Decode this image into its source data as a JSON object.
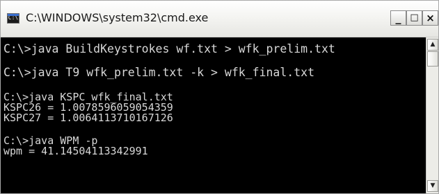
{
  "window": {
    "title": "C:\\WINDOWS\\system32\\cmd.exe",
    "icon": "console-icon",
    "icon_glyph": "C:\\",
    "buttons": {
      "minimize": "_",
      "maximize": "□",
      "close": "×"
    }
  },
  "console": {
    "lines": [
      "C:\\>java BuildKeystrokes wf.txt > wfk_prelim.txt",
      "C:\\>java T9 wfk_prelim.txt -k > wfk_final.txt",
      "C:\\>java KSPC wfk_final.txt",
      "KSPC26 = 1.0078596059054359",
      "KSPC27 = 1.0064113710167126",
      "C:\\>java WPM -p",
      "wpm = 41.14504113342991"
    ],
    "colors": {
      "background": "#000000",
      "text": "#d8d8d8"
    }
  },
  "scrollbar": {
    "up_arrow": "▲",
    "down_arrow": "▼"
  }
}
